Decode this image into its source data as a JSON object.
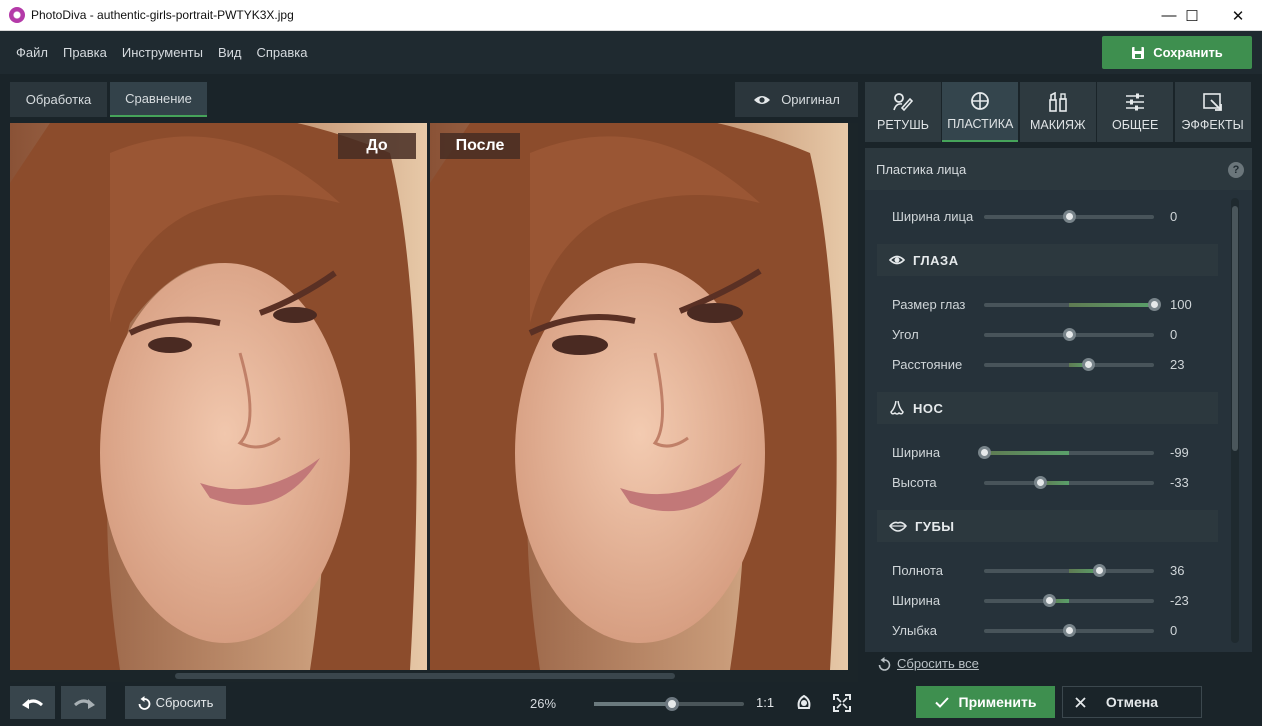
{
  "window": {
    "title": "PhotoDiva - authentic-girls-portrait-PWTYK3X.jpg",
    "minimize": "—",
    "maximize": "☐",
    "close": "✕"
  },
  "menu": [
    "Файл",
    "Правка",
    "Инструменты",
    "Вид",
    "Справка"
  ],
  "save_button": "Сохранить",
  "view_tabs": [
    {
      "label": "Обработка",
      "active": false
    },
    {
      "label": "Сравнение",
      "active": true
    }
  ],
  "original_button": "Оригинал",
  "canvas": {
    "before_label": "До",
    "after_label": "После"
  },
  "bottom": {
    "reset_label": "Сбросить",
    "zoom_percent": "26%",
    "zoom_level": 0.52,
    "one_to_one": "1:1"
  },
  "tool_tabs": [
    {
      "label": "РЕТУШЬ",
      "icon": "retouch-icon",
      "active": false
    },
    {
      "label": "ПЛАСТИКА",
      "icon": "face-plastic-icon",
      "active": true
    },
    {
      "label": "МАКИЯЖ",
      "icon": "makeup-icon",
      "active": false
    },
    {
      "label": "ОБЩЕЕ",
      "icon": "sliders-icon",
      "active": false
    },
    {
      "label": "ЭФФЕКТЫ",
      "icon": "effects-icon",
      "active": false
    }
  ],
  "panel": {
    "title": "Пластика лица",
    "help": "?",
    "face_width": {
      "label": "Ширина лица",
      "value": "0"
    },
    "eyes": {
      "title": "ГЛАЗА",
      "size": {
        "label": "Размер глаз",
        "value": "100"
      },
      "angle": {
        "label": "Угол",
        "value": "0"
      },
      "distance": {
        "label": "Расстояние",
        "value": "23"
      }
    },
    "nose": {
      "title": "НОС",
      "width": {
        "label": "Ширина",
        "value": "-99"
      },
      "height": {
        "label": "Высота",
        "value": "-33"
      }
    },
    "lips": {
      "title": "ГУБЫ",
      "fullness": {
        "label": "Полнота",
        "value": "36"
      },
      "width": {
        "label": "Ширина",
        "value": "-23"
      },
      "smile": {
        "label": "Улыбка",
        "value": "0"
      }
    },
    "reset_all": "Сбросить все"
  },
  "apply_button": "Применить",
  "cancel_button": "Отмена",
  "colors": {
    "accent_green": "#3e8f4f",
    "background": "#1f2a30",
    "panel": "#26323a"
  }
}
